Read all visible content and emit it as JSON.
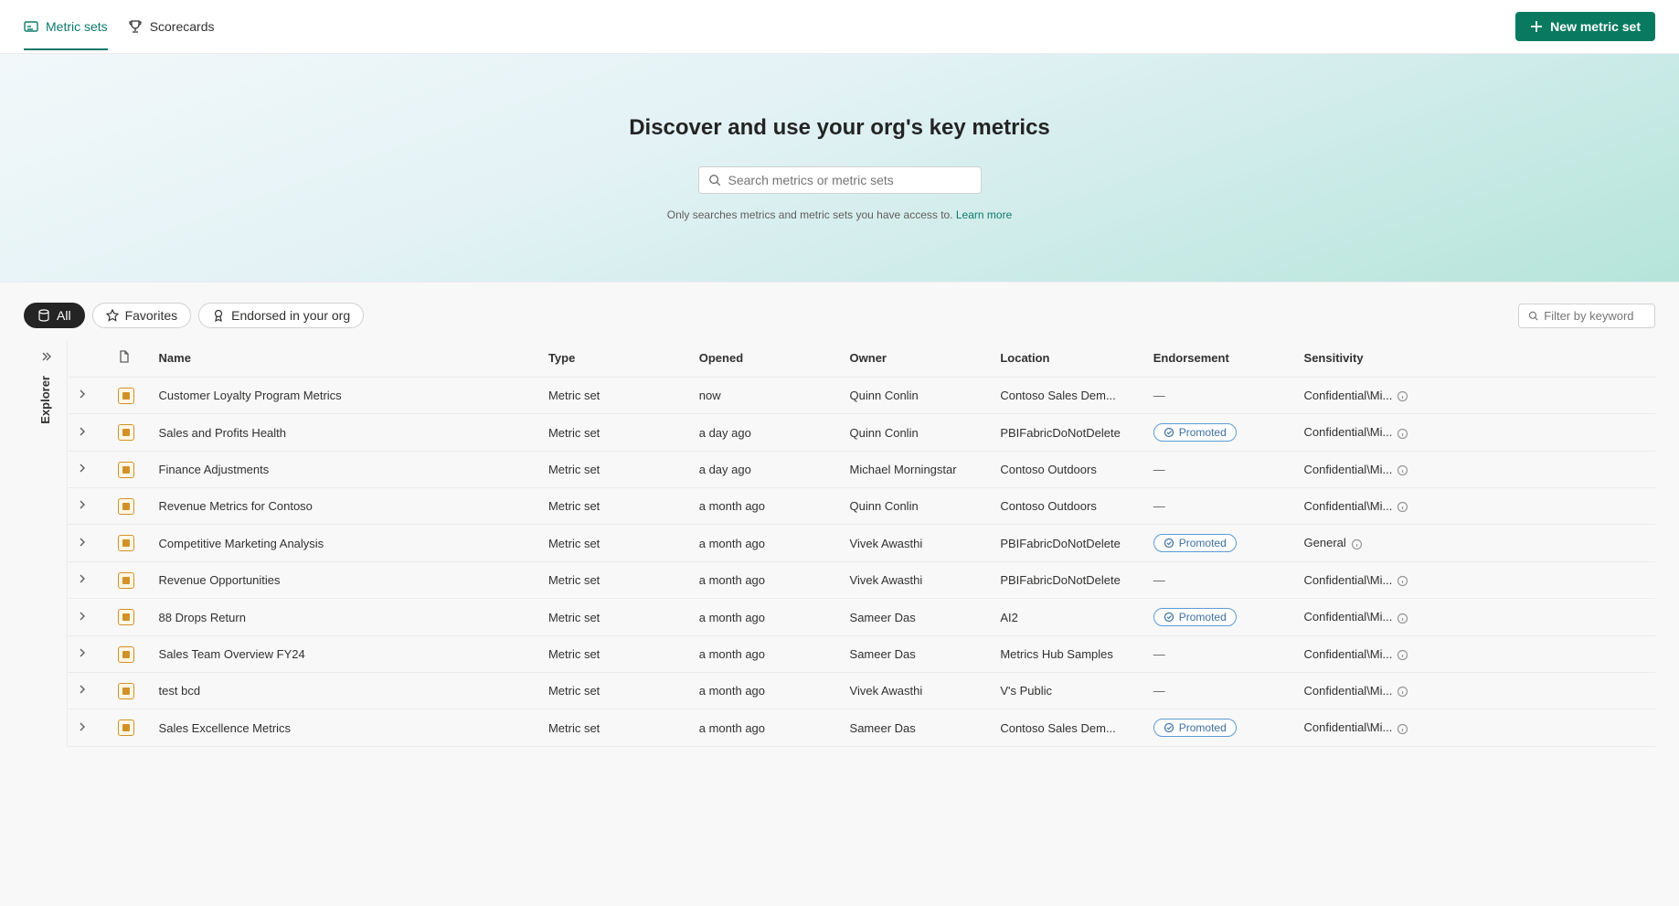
{
  "tabs": {
    "metricSets": "Metric sets",
    "scorecards": "Scorecards"
  },
  "newButton": "New metric set",
  "hero": {
    "title": "Discover and use your org's key metrics",
    "searchPlaceholder": "Search metrics or metric sets",
    "hint": "Only searches metrics and metric sets you have access to. ",
    "learnMore": "Learn more"
  },
  "chips": {
    "all": "All",
    "favorites": "Favorites",
    "endorsed": "Endorsed in your org"
  },
  "filterPlaceholder": "Filter by keyword",
  "explorerLabel": "Explorer",
  "columns": {
    "name": "Name",
    "type": "Type",
    "opened": "Opened",
    "owner": "Owner",
    "location": "Location",
    "endorsement": "Endorsement",
    "sensitivity": "Sensitivity"
  },
  "endorsementLabel": "Promoted",
  "dash": "—",
  "rows": [
    {
      "name": "Customer Loyalty Program Metrics",
      "type": "Metric set",
      "opened": "now",
      "owner": "Quinn Conlin",
      "location": "Contoso Sales Dem...",
      "endorsement": null,
      "sensitivity": "Confidential\\Mi...",
      "sensInfo": true
    },
    {
      "name": "Sales and Profits Health",
      "type": "Metric set",
      "opened": "a day ago",
      "owner": "Quinn Conlin",
      "location": "PBIFabricDoNotDelete",
      "endorsement": "Promoted",
      "sensitivity": "Confidential\\Mi...",
      "sensInfo": true
    },
    {
      "name": "Finance Adjustments",
      "type": "Metric set",
      "opened": "a day ago",
      "owner": "Michael Morningstar",
      "location": "Contoso Outdoors",
      "endorsement": null,
      "sensitivity": "Confidential\\Mi...",
      "sensInfo": true
    },
    {
      "name": "Revenue Metrics for Contoso",
      "type": "Metric set",
      "opened": "a month ago",
      "owner": "Quinn Conlin",
      "location": "Contoso Outdoors",
      "endorsement": null,
      "sensitivity": "Confidential\\Mi...",
      "sensInfo": true
    },
    {
      "name": "Competitive Marketing Analysis",
      "type": "Metric set",
      "opened": "a month ago",
      "owner": "Vivek Awasthi",
      "location": "PBIFabricDoNotDelete",
      "endorsement": "Promoted",
      "sensitivity": "General",
      "sensInfo": true
    },
    {
      "name": "Revenue Opportunities",
      "type": "Metric set",
      "opened": "a month ago",
      "owner": "Vivek Awasthi",
      "location": "PBIFabricDoNotDelete",
      "endorsement": null,
      "sensitivity": "Confidential\\Mi...",
      "sensInfo": true
    },
    {
      "name": "88 Drops Return",
      "type": "Metric set",
      "opened": "a month ago",
      "owner": "Sameer Das",
      "location": "AI2",
      "endorsement": "Promoted",
      "sensitivity": "Confidential\\Mi...",
      "sensInfo": true
    },
    {
      "name": "Sales Team Overview FY24",
      "type": "Metric set",
      "opened": "a month ago",
      "owner": "Sameer Das",
      "location": "Metrics Hub Samples",
      "endorsement": null,
      "sensitivity": "Confidential\\Mi...",
      "sensInfo": true
    },
    {
      "name": "test bcd",
      "type": "Metric set",
      "opened": "a month ago",
      "owner": "Vivek Awasthi",
      "location": "V's Public",
      "endorsement": null,
      "sensitivity": "Confidential\\Mi...",
      "sensInfo": true
    },
    {
      "name": "Sales Excellence Metrics",
      "type": "Metric set",
      "opened": "a month ago",
      "owner": "Sameer Das",
      "location": "Contoso Sales Dem...",
      "endorsement": "Promoted",
      "sensitivity": "Confidential\\Mi...",
      "sensInfo": true
    }
  ]
}
